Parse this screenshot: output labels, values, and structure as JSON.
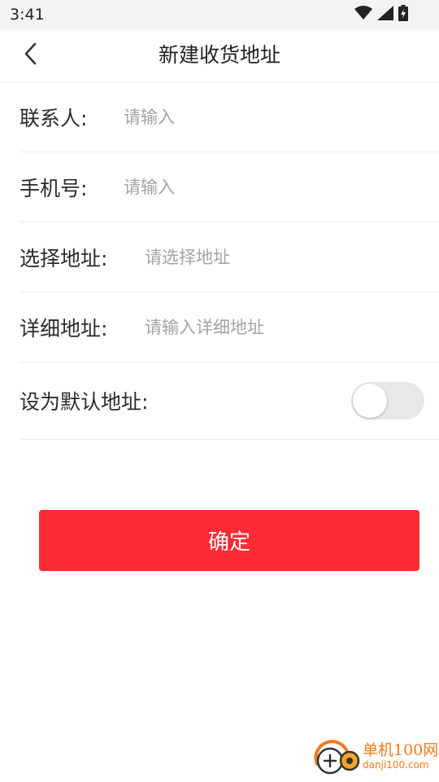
{
  "status_bar": {
    "time": "3:41",
    "icons": [
      "wifi-icon",
      "cellular-signal-icon",
      "battery-charging-icon"
    ]
  },
  "header": {
    "back_icon": "chevron-left-icon",
    "title": "新建收货地址"
  },
  "form": {
    "contact": {
      "label": "联系人:",
      "placeholder": "请输入",
      "value": ""
    },
    "phone": {
      "label": "手机号:",
      "placeholder": "请输入",
      "value": ""
    },
    "region": {
      "label": "选择地址:",
      "placeholder": "请选择地址",
      "value": ""
    },
    "detail": {
      "label": "详细地址:",
      "placeholder": "请输入详细地址",
      "value": ""
    },
    "default_address": {
      "label": "设为默认地址:",
      "enabled": false
    }
  },
  "actions": {
    "confirm_label": "确定"
  },
  "watermark": {
    "name": "单机100网",
    "url": "danji100.com"
  },
  "colors": {
    "accent": "#fd2b36",
    "placeholder": "#a3a3a3",
    "toggle_off": "#e8e8e8",
    "watermark": "#f07b1c"
  }
}
